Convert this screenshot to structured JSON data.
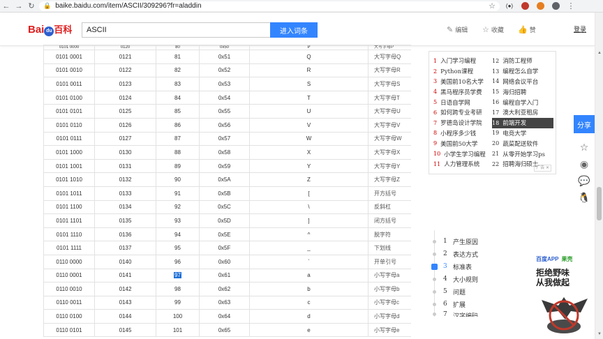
{
  "browser": {
    "url": "baike.baidu.com/item/ASCII/309296?fr=aladdin",
    "ext_label": "(●)"
  },
  "header": {
    "logo_left": "Bai",
    "logo_paw": "du",
    "logo_right": "百科",
    "search_value": "ASCII",
    "search_button": "进入词条",
    "edit_label": "编辑",
    "fav_label": "收藏",
    "like_label": "赞",
    "login_label": "登录"
  },
  "table": {
    "partial_top": [
      "0101 0000",
      "0120",
      "80",
      "0x50",
      "P",
      "大写字母P"
    ],
    "rows": [
      [
        "0101 0001",
        "0121",
        "81",
        "0x51",
        "Q",
        "大写字母Q"
      ],
      [
        "0101 0010",
        "0122",
        "82",
        "0x52",
        "R",
        "大写字母R"
      ],
      [
        "0101 0011",
        "0123",
        "83",
        "0x53",
        "S",
        "大写字母S"
      ],
      [
        "0101 0100",
        "0124",
        "84",
        "0x54",
        "T",
        "大写字母T"
      ],
      [
        "0101 0101",
        "0125",
        "85",
        "0x55",
        "U",
        "大写字母U"
      ],
      [
        "0101 0110",
        "0126",
        "86",
        "0x56",
        "V",
        "大写字母V"
      ],
      [
        "0101 0111",
        "0127",
        "87",
        "0x57",
        "W",
        "大写字母W"
      ],
      [
        "0101 1000",
        "0130",
        "88",
        "0x58",
        "X",
        "大写字母X"
      ],
      [
        "0101 1001",
        "0131",
        "89",
        "0x59",
        "Y",
        "大写字母Y"
      ],
      [
        "0101 1010",
        "0132",
        "90",
        "0x5A",
        "Z",
        "大写字母Z"
      ],
      [
        "0101 1011",
        "0133",
        "91",
        "0x5B",
        "[",
        "开方括号"
      ],
      [
        "0101 1100",
        "0134",
        "92",
        "0x5C",
        "\\",
        "反斜杠"
      ],
      [
        "0101 1101",
        "0135",
        "93",
        "0x5D",
        "]",
        "闭方括号"
      ],
      [
        "0101 1110",
        "0136",
        "94",
        "0x5E",
        "^",
        "脱字符"
      ],
      [
        "0101 1111",
        "0137",
        "95",
        "0x5F",
        "_",
        "下划线"
      ],
      [
        "0110 0000",
        "0140",
        "96",
        "0x60",
        "`",
        "开单引号"
      ],
      [
        "0110 0001",
        "0141",
        "97",
        "0x61",
        "a",
        "小写字母a"
      ],
      [
        "0110 0010",
        "0142",
        "98",
        "0x62",
        "b",
        "小写字母b"
      ],
      [
        "0110 0011",
        "0143",
        "99",
        "0x63",
        "c",
        "小写字母c"
      ],
      [
        "0110 0100",
        "0144",
        "100",
        "0x64",
        "d",
        "小写字母d"
      ],
      [
        "0110 0101",
        "0145",
        "101",
        "0x65",
        "e",
        "小写字母e"
      ]
    ],
    "highlighted_row": 16,
    "highlighted_col": 2
  },
  "ad": {
    "items": [
      {
        "n": "1",
        "t": "入门学习编程"
      },
      {
        "n": "12",
        "t": "消防工程师"
      },
      {
        "n": "2",
        "t": "Python课程"
      },
      {
        "n": "13",
        "t": "编程怎么自学"
      },
      {
        "n": "3",
        "t": "美国前10名大学"
      },
      {
        "n": "14",
        "t": "网络会议平台"
      },
      {
        "n": "4",
        "t": "黑马程序员学费"
      },
      {
        "n": "15",
        "t": "海归招聘"
      },
      {
        "n": "5",
        "t": "日语自学网"
      },
      {
        "n": "16",
        "t": "编程自学入门"
      },
      {
        "n": "6",
        "t": "如何跨专业考研"
      },
      {
        "n": "17",
        "t": "澳大利亚租房"
      },
      {
        "n": "7",
        "t": "罗德岛设计学院"
      },
      {
        "n": "18",
        "t": "前端开发"
      },
      {
        "n": "8",
        "t": "小程序多少钱"
      },
      {
        "n": "19",
        "t": "电竞大学"
      },
      {
        "n": "9",
        "t": "美国前50大学"
      },
      {
        "n": "20",
        "t": "蔬菜配送软件"
      },
      {
        "n": "10",
        "t": "小学生学习编程"
      },
      {
        "n": "21",
        "t": "从零开始学习ps"
      },
      {
        "n": "11",
        "t": "人力管理系统"
      },
      {
        "n": "22",
        "t": "招聘海归硕士"
      }
    ],
    "selected_index": 13,
    "tag": "广告"
  },
  "share": {
    "title": "分享"
  },
  "directory": {
    "items": [
      {
        "n": "1",
        "t": "产生原因"
      },
      {
        "n": "2",
        "t": "表达方式"
      },
      {
        "n": "3",
        "t": "标准表"
      },
      {
        "n": "4",
        "t": "大小规则"
      },
      {
        "n": "5",
        "t": "问题"
      },
      {
        "n": "6",
        "t": "扩展"
      },
      {
        "n": "7",
        "t": "汉字编码"
      }
    ],
    "active_index": 2
  },
  "promo": {
    "app_name": "百度APP",
    "partner": "果壳",
    "line1": "拒绝野味",
    "line2": "从我做起"
  },
  "colors": {
    "accent": "#3385ff",
    "logo_red": "#de1e1e",
    "highlight": "#1e6fd8"
  }
}
